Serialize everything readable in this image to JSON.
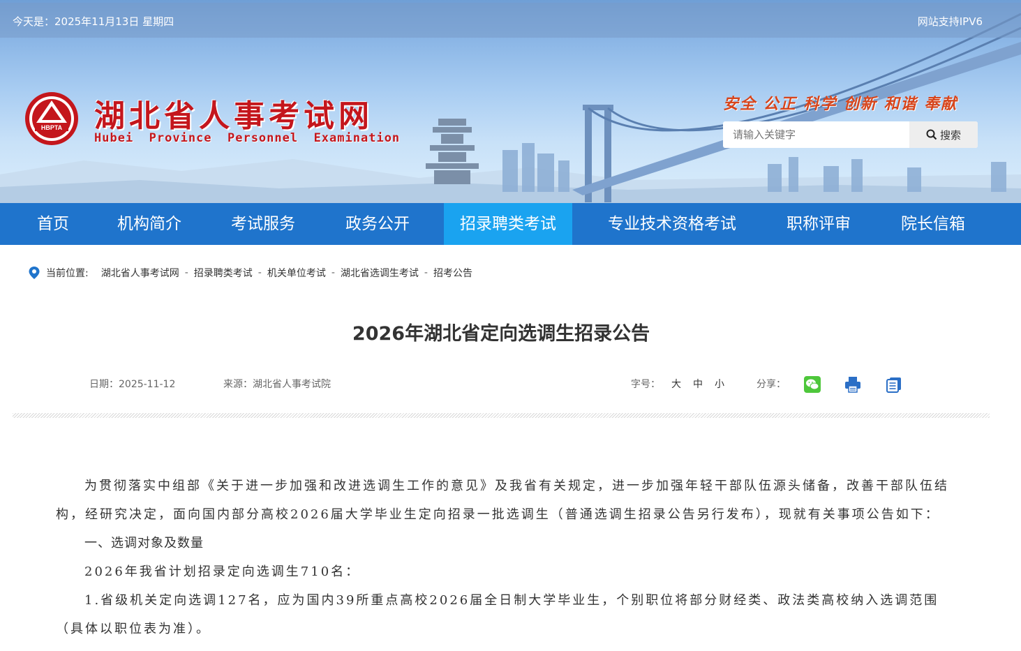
{
  "header": {
    "date_text": "今天是：2025年11月13日 星期四",
    "ipv6_text": "网站支持IPV6",
    "logo_abbr": "HBPTA",
    "site_title": "湖北省人事考试网",
    "site_subtitle": "Hubei  Province  Personnel  Examination",
    "slogan": "安全 公正 科学 创新 和谐 奉献",
    "search_placeholder": "请输入关键字",
    "search_button": "搜索"
  },
  "nav": {
    "items": [
      {
        "label": "首页"
      },
      {
        "label": "机构简介"
      },
      {
        "label": "考试服务"
      },
      {
        "label": "政务公开"
      },
      {
        "label": "招录聘类考试",
        "active": true
      },
      {
        "label": "专业技术资格考试"
      },
      {
        "label": "职称评审"
      },
      {
        "label": "院长信箱"
      }
    ]
  },
  "breadcrumb": {
    "label": "当前位置:",
    "items": [
      "湖北省人事考试网",
      "招录聘类考试",
      "机关单位考试",
      "湖北省选调生考试",
      "招考公告"
    ],
    "separator": "-"
  },
  "article": {
    "title": "2026年湖北省定向选调生招录公告",
    "date": "日期：2025-11-12",
    "source": "来源：湖北省人事考试院",
    "font_size_label": "字号：",
    "font_sizes": [
      "大",
      "中",
      "小"
    ],
    "share_label": "分享：",
    "share_icons": [
      "wechat-icon",
      "print-icon",
      "copy-icon"
    ],
    "paragraphs": [
      "为贯彻落实中组部《关于进一步加强和改进选调生工作的意见》及我省有关规定，进一步加强年轻干部队伍源头储备，改善干部队伍结构，经研究决定，面向国内部分高校2026届大学毕业生定向招录一批选调生（普通选调生招录公告另行发布），现就有关事项公告如下：",
      "一、选调对象及数量",
      "2026年我省计划招录定向选调生710名：",
      "1.省级机关定向选调127名，应为国内39所重点高校2026届全日制大学毕业生，个别职位将部分财经类、政法类高校纳入选调范围（具体以职位表为准）。"
    ]
  },
  "colors": {
    "nav_bg": "#1f74cc",
    "nav_active": "#1aa3f0",
    "brand_red": "#c4161c",
    "slogan_orange": "#d6451c"
  }
}
